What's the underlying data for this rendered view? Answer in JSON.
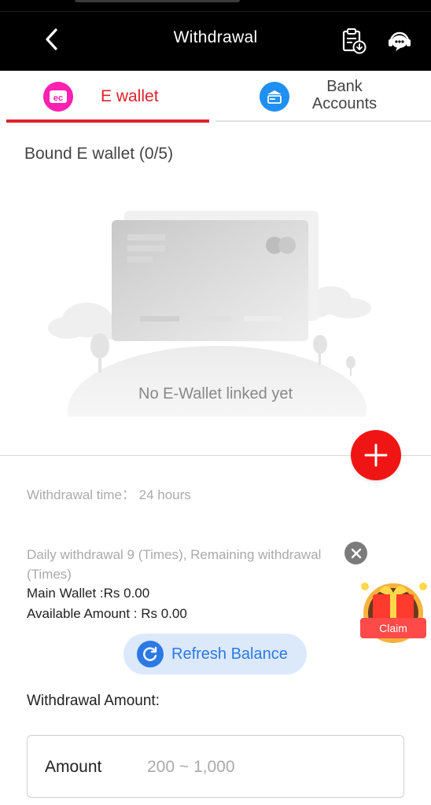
{
  "header": {
    "title": "Withdrawal",
    "back_icon": "chevron-left-icon",
    "records_icon": "clipboard-download-icon",
    "support_icon": "headset-support-icon"
  },
  "tabs": [
    {
      "label": "E wallet",
      "icon": "wallet-icon",
      "active": true,
      "color": "#ff1fb0"
    },
    {
      "label": "Bank Accounts",
      "icon": "bank-card-icon",
      "active": false,
      "color": "#1f8ff0"
    }
  ],
  "ewallet": {
    "bound_title": "Bound E wallet (0/5)",
    "empty_text": "No E-Wallet linked yet"
  },
  "info": {
    "withdrawal_time": "Withdrawal time： 24 hours",
    "daily_limit": "Daily withdrawal 9 (Times), Remaining withdrawal (Times)",
    "main_wallet": "Main Wallet :Rs 0.00",
    "available_amount": "Available Amount : Rs 0.00"
  },
  "refresh": {
    "label": "Refresh Balance"
  },
  "gift": {
    "claim_label": "Claim"
  },
  "amount": {
    "section_label": "Withdrawal Amount:",
    "field_label": "Amount",
    "placeholder": "200 ~ 1,000",
    "value": ""
  },
  "colors": {
    "accent_red": "#e0212a",
    "add_button": "#f01515",
    "refresh_blue": "#2c79e6",
    "header_bg": "#000000"
  }
}
